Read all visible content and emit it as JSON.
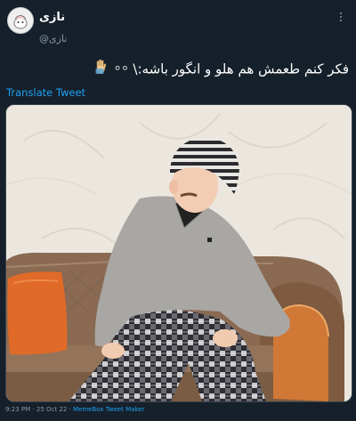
{
  "header": {
    "display_name": "نازی",
    "handle": "@نازی"
  },
  "tweet": {
    "text": "فکر کنم طعمش هم هلو و انگور باشه:\\",
    "translate_label": "Translate Tweet"
  },
  "footer": {
    "time": "9:23 PM",
    "separator": "·",
    "date": "25 Oct 22",
    "via": "MemeBox Tweet Maker"
  },
  "media": {
    "description_colors": {
      "wall": "#ebe7df",
      "sofa": "#8a6a52",
      "pillow": "#e06a28",
      "sweater": "#a9a7a4",
      "hat_stripe": "#2b2a2e"
    }
  },
  "colors": {
    "background": "#15202b",
    "accent": "#1da1f2",
    "muted": "#8899a6"
  }
}
